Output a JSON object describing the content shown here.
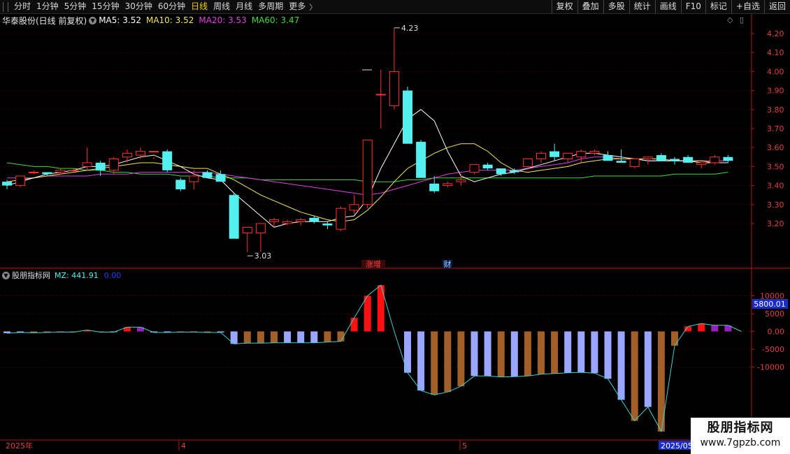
{
  "toolbar": {
    "tabs": [
      "分时",
      "1分钟",
      "5分钟",
      "15分钟",
      "30分钟",
      "60分钟",
      "日线",
      "周线",
      "月线",
      "多周期",
      "更多"
    ],
    "active_tab": "日线",
    "right_buttons": [
      "复权",
      "叠加",
      "多股",
      "统计",
      "画线",
      "F10",
      "标记",
      "+自选",
      "返回"
    ]
  },
  "stock": {
    "title": "华泰股份(日线 前复权)",
    "ma_labels": [
      "MA5: 3.52",
      "MA10: 3.52",
      "MA20: 3.53",
      "MA60: 3.47"
    ],
    "ma_colors": [
      "#ffffff",
      "#f5e65a",
      "#e040e0",
      "#3cdc3c"
    ]
  },
  "indicator": {
    "title": "股朋指标网",
    "mz_label": "MZ: 441.91",
    "value2": "0.00",
    "current_tag": "5800.01"
  },
  "price_axis": [
    "4.20",
    "4.10",
    "4.00",
    "3.90",
    "3.80",
    "3.70",
    "3.60",
    "3.50",
    "3.40",
    "3.30",
    "3.20"
  ],
  "ind_axis": [
    "10000",
    "5000",
    "0.00",
    "-5000",
    "-10000"
  ],
  "annotations": {
    "high": "4.23",
    "low": "3.03",
    "event1": "涨增",
    "event2": "财"
  },
  "date_axis": {
    "start": "2025年",
    "m4": "4",
    "m5": "5",
    "current": "2025/05"
  },
  "watermark": {
    "title": "股朋指标网",
    "url": "www.7gpzb.com"
  },
  "colors": {
    "up": "#ff3030",
    "down": "#54f0f0",
    "mz_pos": "#ff1010",
    "mz_purple": "#9a1fbf",
    "mz_blue": "#9aa6ff",
    "mz_brown": "#a25f28",
    "grid": "#5a0000",
    "axis": "#c01010"
  },
  "chart_data": {
    "type": "candlestick",
    "candles": [
      [
        3.42,
        3.43,
        3.38,
        3.4
      ],
      [
        3.4,
        3.45,
        3.39,
        3.45
      ],
      [
        3.47,
        3.48,
        3.46,
        3.47
      ],
      [
        3.47,
        3.47,
        3.45,
        3.46
      ],
      [
        3.47,
        3.49,
        3.46,
        3.48
      ],
      [
        3.48,
        3.49,
        3.47,
        3.48
      ],
      [
        3.5,
        3.6,
        3.48,
        3.52
      ],
      [
        3.52,
        3.53,
        3.45,
        3.48
      ],
      [
        3.48,
        3.55,
        3.46,
        3.54
      ],
      [
        3.55,
        3.59,
        3.52,
        3.57
      ],
      [
        3.56,
        3.6,
        3.54,
        3.58
      ],
      [
        3.58,
        3.55,
        3.54,
        3.58
      ],
      [
        3.58,
        3.59,
        3.47,
        3.48
      ],
      [
        3.43,
        3.44,
        3.37,
        3.38
      ],
      [
        3.42,
        3.48,
        3.38,
        3.45
      ],
      [
        3.47,
        3.48,
        3.44,
        3.44
      ],
      [
        3.46,
        3.48,
        3.45,
        3.42
      ],
      [
        3.35,
        3.36,
        3.12,
        3.12
      ],
      [
        3.15,
        3.17,
        3.05,
        3.18
      ],
      [
        3.15,
        3.2,
        3.05,
        3.2
      ],
      [
        3.21,
        3.23,
        3.18,
        3.22
      ],
      [
        3.2,
        3.22,
        3.19,
        3.21
      ],
      [
        3.21,
        3.23,
        3.19,
        3.22
      ],
      [
        3.23,
        3.24,
        3.2,
        3.21
      ],
      [
        3.2,
        3.21,
        3.17,
        3.19
      ],
      [
        3.17,
        3.29,
        3.16,
        3.28
      ],
      [
        3.27,
        3.35,
        3.25,
        3.3
      ],
      [
        3.3,
        3.64,
        3.28,
        3.64
      ],
      [
        3.88,
        4.01,
        3.7,
        3.88
      ],
      [
        3.82,
        4.23,
        3.8,
        4.0
      ],
      [
        3.9,
        3.92,
        3.62,
        3.62
      ],
      [
        3.63,
        3.64,
        3.44,
        3.44
      ],
      [
        3.41,
        3.45,
        3.36,
        3.37
      ],
      [
        3.4,
        3.42,
        3.39,
        3.41
      ],
      [
        3.42,
        3.46,
        3.4,
        3.43
      ],
      [
        3.47,
        3.51,
        3.46,
        3.51
      ],
      [
        3.51,
        3.52,
        3.48,
        3.49
      ],
      [
        3.49,
        3.49,
        3.45,
        3.46
      ],
      [
        3.48,
        3.49,
        3.46,
        3.47
      ],
      [
        3.5,
        3.54,
        3.48,
        3.54
      ],
      [
        3.54,
        3.58,
        3.52,
        3.57
      ],
      [
        3.58,
        3.62,
        3.53,
        3.55
      ],
      [
        3.54,
        3.57,
        3.52,
        3.57
      ],
      [
        3.55,
        3.59,
        3.52,
        3.58
      ],
      [
        3.57,
        3.59,
        3.56,
        3.58
      ],
      [
        3.56,
        3.58,
        3.53,
        3.53
      ],
      [
        3.53,
        3.59,
        3.52,
        3.52
      ],
      [
        3.5,
        3.54,
        3.49,
        3.54
      ],
      [
        3.54,
        3.55,
        3.51,
        3.55
      ],
      [
        3.56,
        3.57,
        3.53,
        3.53
      ],
      [
        3.54,
        3.55,
        3.51,
        3.53
      ],
      [
        3.55,
        3.56,
        3.52,
        3.52
      ],
      [
        3.51,
        3.52,
        3.49,
        3.52
      ],
      [
        3.52,
        3.56,
        3.51,
        3.55
      ],
      [
        3.55,
        3.56,
        3.52,
        3.53
      ]
    ],
    "ma5": [
      3.4,
      3.42,
      3.44,
      3.46,
      3.47,
      3.48,
      3.5,
      3.5,
      3.51,
      3.53,
      3.55,
      3.56,
      3.53,
      3.5,
      3.46,
      3.44,
      3.43,
      3.36,
      3.3,
      3.24,
      3.18,
      3.2,
      3.21,
      3.21,
      3.21,
      3.23,
      3.24,
      3.33,
      3.49,
      3.62,
      3.75,
      3.8,
      3.74,
      3.58,
      3.45,
      3.42,
      3.44,
      3.46,
      3.47,
      3.49,
      3.51,
      3.53,
      3.55,
      3.57,
      3.57,
      3.56,
      3.55,
      3.54,
      3.53,
      3.53,
      3.53,
      3.53,
      3.52,
      3.52,
      3.52
    ],
    "ma10": [
      3.42,
      3.43,
      3.44,
      3.45,
      3.46,
      3.47,
      3.48,
      3.49,
      3.5,
      3.51,
      3.52,
      3.52,
      3.51,
      3.5,
      3.49,
      3.49,
      3.46,
      3.43,
      3.39,
      3.35,
      3.32,
      3.29,
      3.26,
      3.24,
      3.22,
      3.21,
      3.22,
      3.27,
      3.34,
      3.42,
      3.49,
      3.53,
      3.57,
      3.6,
      3.62,
      3.62,
      3.58,
      3.52,
      3.48,
      3.47,
      3.48,
      3.49,
      3.5,
      3.52,
      3.53,
      3.54,
      3.54,
      3.54,
      3.54,
      3.54,
      3.53,
      3.53,
      3.53,
      3.52,
      3.52
    ],
    "ma20": [
      3.44,
      3.44,
      3.44,
      3.45,
      3.45,
      3.45,
      3.45,
      3.46,
      3.46,
      3.46,
      3.47,
      3.47,
      3.47,
      3.47,
      3.47,
      3.47,
      3.46,
      3.45,
      3.44,
      3.43,
      3.42,
      3.41,
      3.4,
      3.39,
      3.38,
      3.37,
      3.36,
      3.35,
      3.36,
      3.38,
      3.4,
      3.42,
      3.44,
      3.46,
      3.47,
      3.48,
      3.48,
      3.48,
      3.48,
      3.49,
      3.5,
      3.51,
      3.52,
      3.54,
      3.55,
      3.55,
      3.54,
      3.54,
      3.53,
      3.53,
      3.53,
      3.53,
      3.53,
      3.53,
      3.53
    ],
    "ma60": [
      3.52,
      3.51,
      3.5,
      3.5,
      3.49,
      3.49,
      3.48,
      3.48,
      3.47,
      3.47,
      3.46,
      3.46,
      3.46,
      3.45,
      3.45,
      3.45,
      3.44,
      3.44,
      3.44,
      3.43,
      3.43,
      3.43,
      3.43,
      3.43,
      3.43,
      3.43,
      3.43,
      3.42,
      3.42,
      3.42,
      3.43,
      3.43,
      3.44,
      3.44,
      3.44,
      3.44,
      3.44,
      3.44,
      3.44,
      3.44,
      3.44,
      3.44,
      3.44,
      3.44,
      3.45,
      3.45,
      3.45,
      3.45,
      3.45,
      3.45,
      3.46,
      3.46,
      3.46,
      3.46,
      3.47
    ],
    "mz_bars": [
      -500,
      -300,
      -400,
      -300,
      -200,
      -200,
      400,
      -200,
      -200,
      1200,
      1200,
      -300,
      -300,
      -200,
      -200,
      -300,
      -300,
      -3500,
      -3300,
      -3300,
      -3200,
      -3200,
      -3200,
      -3200,
      -3000,
      -2800,
      3800,
      10000,
      13000,
      0,
      -11600,
      -16600,
      -17800,
      -17000,
      -15400,
      -12500,
      -12500,
      -12800,
      -12700,
      -12500,
      -12000,
      -11800,
      -11600,
      -11500,
      -11700,
      -13300,
      -19200,
      -25100,
      -21200,
      -28100,
      -4000,
      1400,
      2200,
      1700,
      1700,
      0
    ],
    "mz_bar_colors": [
      "b",
      "b",
      "br",
      "br",
      "br",
      "br",
      "r",
      "br",
      "b",
      "r",
      "p",
      "b",
      "b",
      "br",
      "br",
      "br",
      "b",
      "b",
      "br",
      "br",
      "br",
      "b",
      "b",
      "b",
      "br",
      "br",
      "r",
      "r",
      "r",
      "n",
      "b",
      "b",
      "br",
      "br",
      "br",
      "b",
      "b",
      "br",
      "b",
      "br",
      "br",
      "br",
      "b",
      "b",
      "b",
      "b",
      "b",
      "br",
      "b",
      "br",
      "br",
      "r",
      "r",
      "p",
      "p",
      "n"
    ],
    "mz_line": [
      -500,
      -300,
      -400,
      -300,
      -200,
      -200,
      300,
      -200,
      -200,
      1000,
      1000,
      -300,
      -300,
      -200,
      -200,
      -300,
      -300,
      -3500,
      -3300,
      -3300,
      -3200,
      -3200,
      -3200,
      -3200,
      -3000,
      -2800,
      3800,
      10000,
      3200,
      13000,
      0,
      -11600,
      -16600,
      -17800,
      -17000,
      -15400,
      -12500,
      -12500,
      -12800,
      -12700,
      -12500,
      -12000,
      -11800,
      -11600,
      -11500,
      -11700,
      -13300,
      -19200,
      -25100,
      -21200,
      -28100,
      -4000,
      1400,
      2200,
      1700,
      1700,
      0
    ]
  }
}
